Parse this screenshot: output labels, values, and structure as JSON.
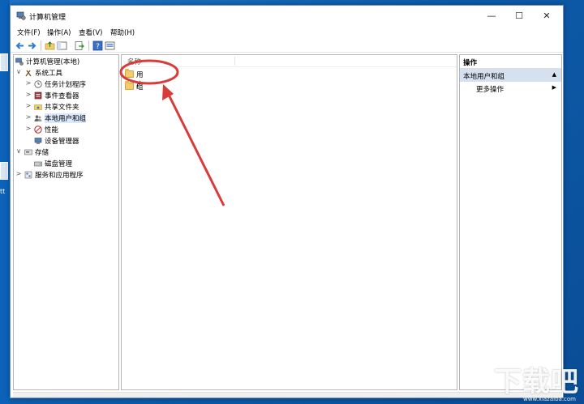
{
  "window": {
    "title": "计算机管理",
    "minimize_glyph": "—",
    "maximize_glyph": "☐",
    "close_glyph": "✕"
  },
  "menu": {
    "items": [
      "文件(F)",
      "操作(A)",
      "查看(V)",
      "帮助(H)"
    ]
  },
  "toolbar": {
    "icons": [
      "back-arrow-icon",
      "forward-arrow-icon",
      "up-folder-icon",
      "show-hide-tree-icon",
      "export-list-icon",
      "help-icon",
      "properties-icon"
    ]
  },
  "tree": {
    "root": "计算机管理(本地)",
    "items": [
      {
        "label": "系统工具",
        "expander": "∨"
      },
      {
        "label": "任务计划程序",
        "expander": ">"
      },
      {
        "label": "事件查看器",
        "expander": ">"
      },
      {
        "label": "共享文件夹",
        "expander": ">"
      },
      {
        "label": "本地用户和组",
        "expander": ">"
      },
      {
        "label": "性能",
        "expander": ">"
      },
      {
        "label": "设备管理器",
        "expander": ""
      },
      {
        "label": "存储",
        "expander": "∨"
      },
      {
        "label": "磁盘管理",
        "expander": ""
      },
      {
        "label": "服务和应用程序",
        "expander": ">"
      }
    ]
  },
  "center": {
    "column_header": "名称",
    "rows": [
      "用户",
      "组"
    ]
  },
  "actions": {
    "header": "操作",
    "group": "本地用户和组",
    "group_toggle": "▲",
    "more": "更多操作",
    "more_arrow": "▶"
  },
  "desktop": {
    "side_text": "tt"
  },
  "watermark": {
    "main": "下载吧",
    "sub": "www.xiazaiba.com"
  },
  "colors": {
    "annotation": "#d93b3b",
    "selection": "#d9e8fb",
    "actions_group": "#d6e1f0",
    "folder": "#f2cd6b"
  }
}
